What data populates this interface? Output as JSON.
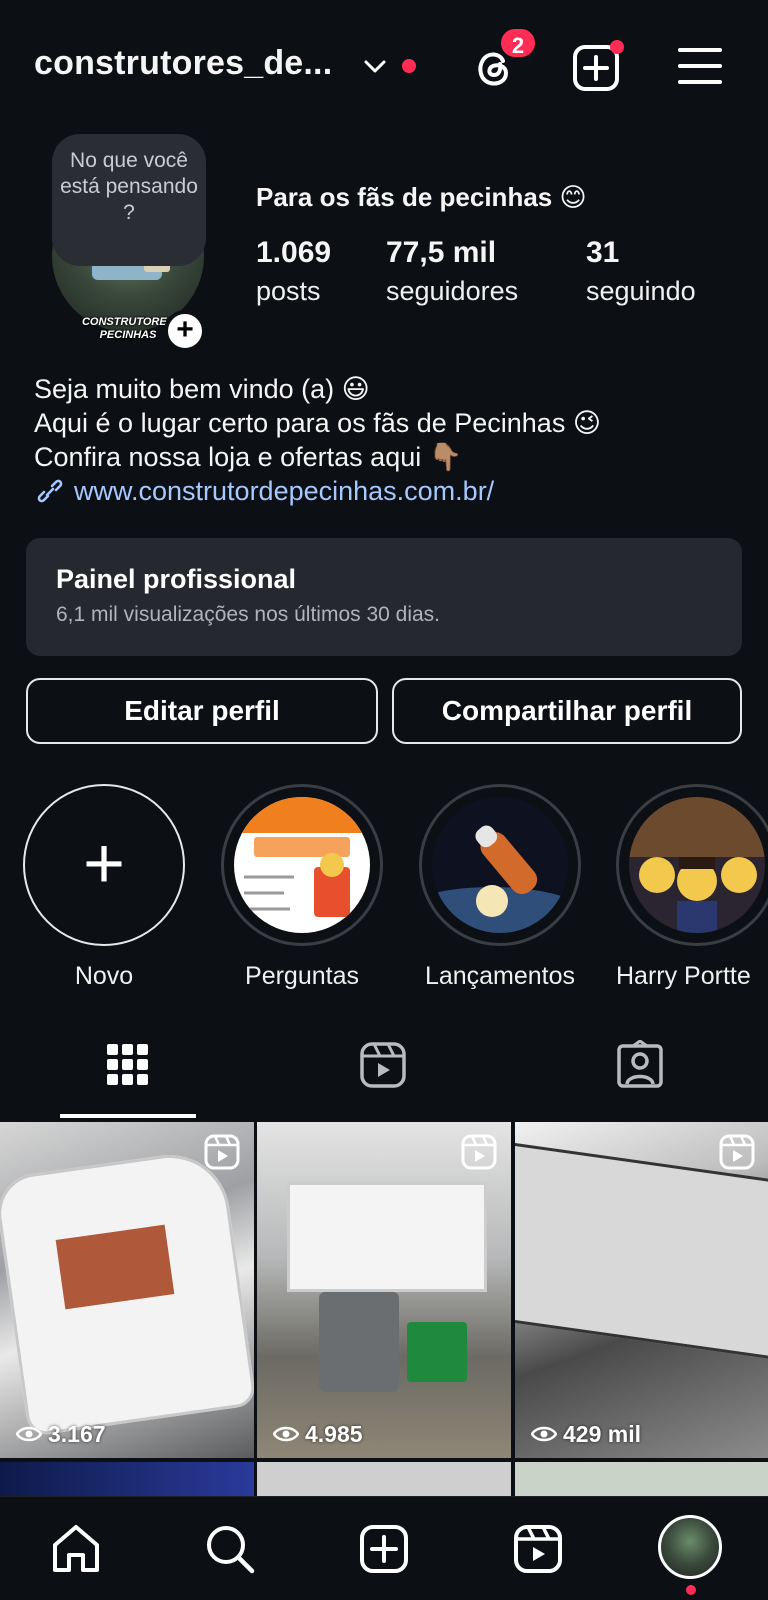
{
  "header": {
    "username": "construtores_de...",
    "threads_badge": "2"
  },
  "profile": {
    "note": "No que você está pensando ?",
    "avatar_label": "CONSTRUTORES PECINHAS",
    "name": "Para os fãs de pecinhas 😊",
    "stats": [
      {
        "value": "1.069",
        "label": "posts"
      },
      {
        "value": "77,5 mil",
        "label": "seguidores"
      },
      {
        "value": "31",
        "label": "seguindo"
      }
    ],
    "bio": [
      "Seja muito bem vindo (a) 😃",
      "Aqui é o lugar certo para os fãs de Pecinhas 😉",
      "Confira nossa loja e ofertas aqui 👇🏽"
    ],
    "link": "www.construtordepecinhas.com.br/"
  },
  "panel": {
    "title": "Painel profissional",
    "subtitle": "6,1 mil visualizações nos últimos 30 dias."
  },
  "buttons": {
    "edit": "Editar perfil",
    "share": "Compartilhar perfil"
  },
  "highlights": [
    {
      "label": "Novo"
    },
    {
      "label": "Perguntas"
    },
    {
      "label": "Lançamentos"
    },
    {
      "label": "Harry Portte"
    }
  ],
  "grid": [
    {
      "views": "3.167"
    },
    {
      "views": "4.985"
    },
    {
      "views": "429 mil"
    }
  ],
  "colors": {
    "background": "#0c0f14",
    "badge": "#ff2d55",
    "link": "#a5c8ff",
    "panel": "#25282e"
  }
}
